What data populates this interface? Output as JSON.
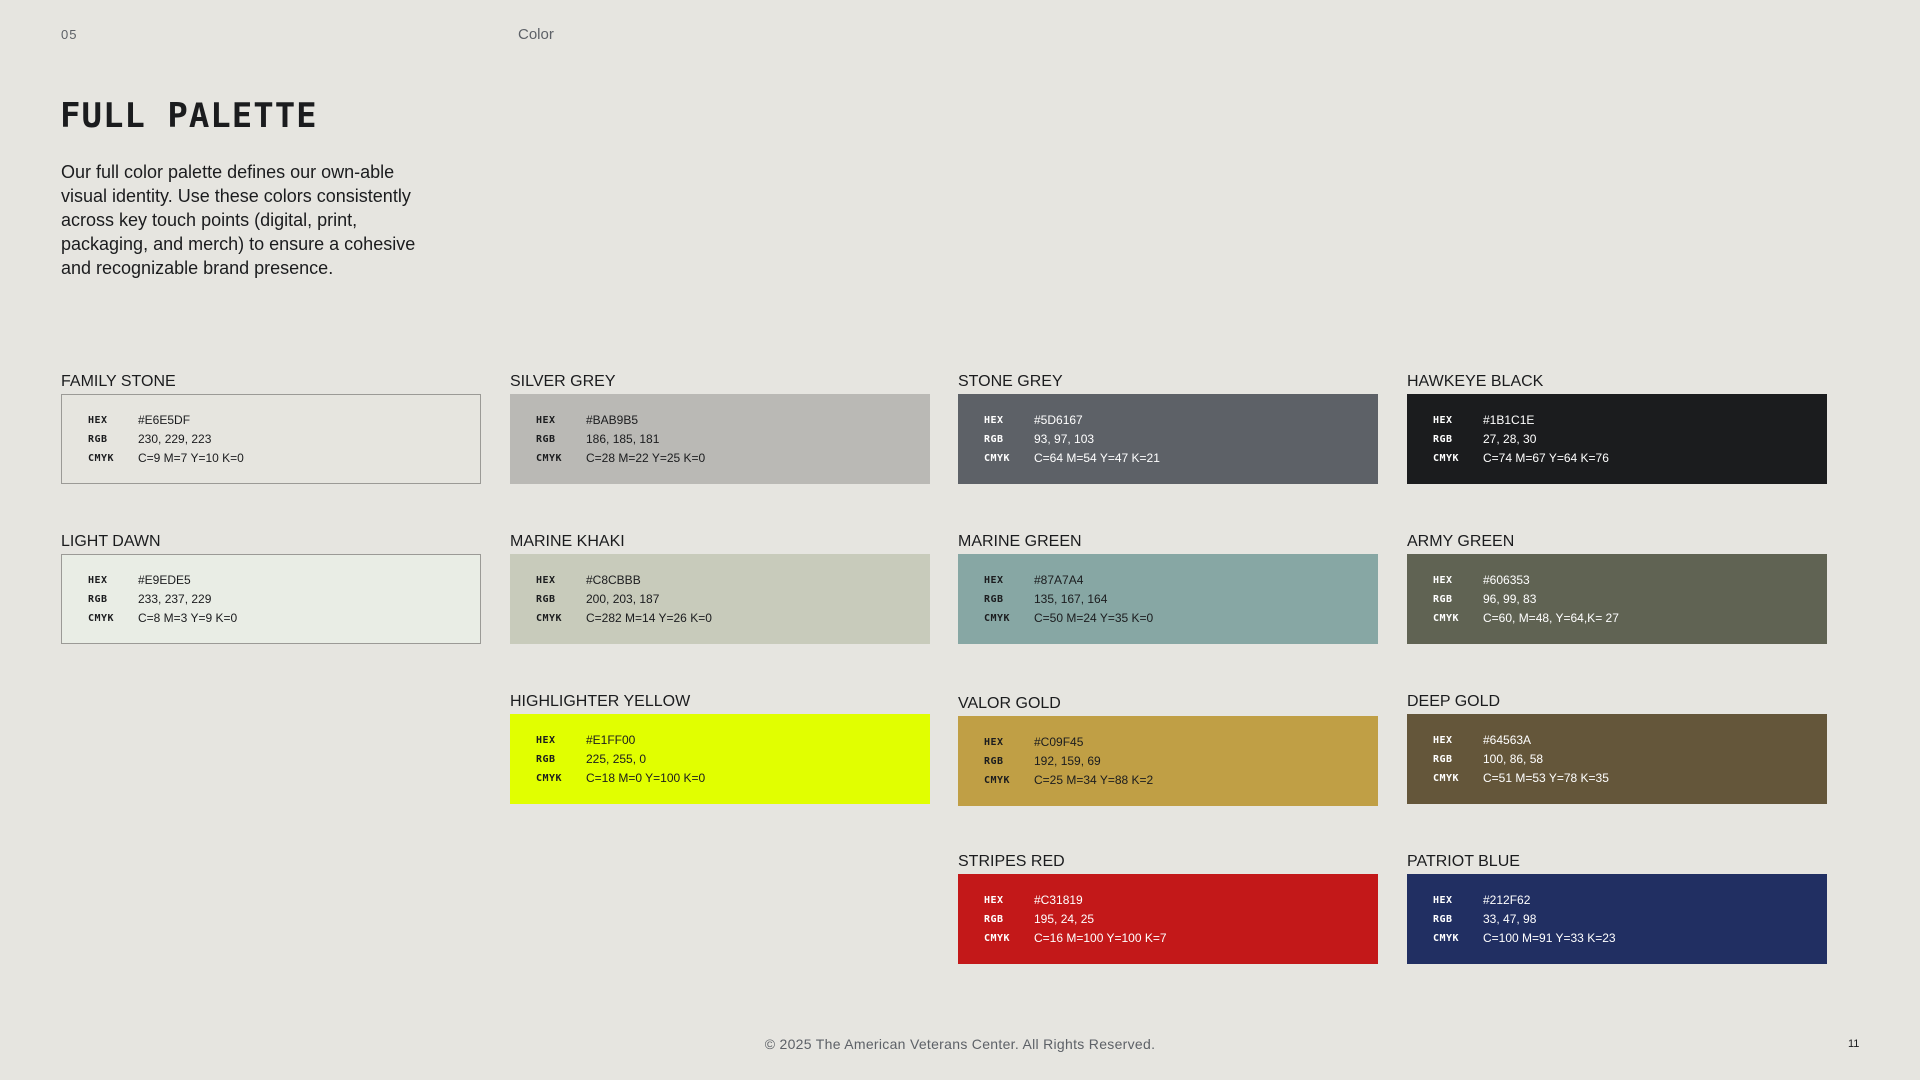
{
  "header": {
    "page_number": "05",
    "section": "Color"
  },
  "title": "FULL PALETTE",
  "intro": "Our full color palette defines our own-able visual identity. Use these colors consistently across key touch points (digital, print, packaging, and merch) to ensure a cohesive and recognizable brand presence.",
  "labels": {
    "hex": "HEX",
    "rgb": "RGB",
    "cmyk": "CMYK"
  },
  "swatches": [
    {
      "name": "FAMILY STONE",
      "hex": "#E6E5DF",
      "rgb": "230, 229, 223",
      "cmyk": "C=9 M=7 Y=10 K=0",
      "color": "#E6E5DF",
      "text_color": "#1B1C1E",
      "bordered": true
    },
    {
      "name": "SILVER GREY",
      "hex": "#BAB9B5",
      "rgb": "186, 185, 181",
      "cmyk": "C=28 M=22 Y=25 K=0",
      "color": "#BAB9B5",
      "text_color": "#1B1C1E",
      "bordered": false
    },
    {
      "name": "STONE GREY",
      "hex": "#5D6167",
      "rgb": "93, 97, 103",
      "cmyk": "C=64 M=54 Y=47 K=21",
      "color": "#5D6167",
      "text_color": "#FFFFFF",
      "bordered": false
    },
    {
      "name": "HAWKEYE BLACK",
      "hex": "#1B1C1E",
      "rgb": "27, 28, 30",
      "cmyk": "C=74 M=67 Y=64 K=76",
      "color": "#1B1C1E",
      "text_color": "#FFFFFF",
      "bordered": false
    },
    {
      "name": "LIGHT DAWN",
      "hex": "#E9EDE5",
      "rgb": "233, 237, 229",
      "cmyk": "C=8 M=3 Y=9 K=0",
      "color": "#E9EDE5",
      "text_color": "#1B1C1E",
      "bordered": true
    },
    {
      "name": "MARINE KHAKI",
      "hex": "#C8CBBB",
      "rgb": "200, 203, 187",
      "cmyk": "C=282 M=14 Y=26 K=0",
      "color": "#C8CBBB",
      "text_color": "#1B1C1E",
      "bordered": false
    },
    {
      "name": "MARINE GREEN",
      "hex": "#87A7A4",
      "rgb": "135, 167, 164",
      "cmyk": "C=50 M=24 Y=35 K=0",
      "color": "#87A7A4",
      "text_color": "#1B1C1E",
      "bordered": false
    },
    {
      "name": "ARMY GREEN",
      "hex": "#606353",
      "rgb": "96, 99, 83",
      "cmyk": "C=60, M=48, Y=64,K= 27",
      "color": "#606353",
      "text_color": "#FFFFFF",
      "bordered": false
    },
    {
      "name": "HIGHLIGHTER YELLOW",
      "hex": "#E1FF00",
      "rgb": "225, 255, 0",
      "cmyk": "C=18 M=0 Y=100 K=0",
      "color": "#E1FF00",
      "text_color": "#1B1C1E",
      "bordered": false
    },
    {
      "name": "VALOR GOLD",
      "hex": "#C09F45",
      "rgb": "192, 159, 69",
      "cmyk": "C=25 M=34 Y=88 K=2",
      "color": "#C09F45",
      "text_color": "#1B1C1E",
      "bordered": false
    },
    {
      "name": "DEEP GOLD",
      "hex": "#64563A",
      "rgb": "100, 86, 58",
      "cmyk": "C=51 M=53 Y=78 K=35",
      "color": "#64563A",
      "text_color": "#FFFFFF",
      "bordered": false
    },
    {
      "name": "STRIPES RED",
      "hex": "#C31819",
      "rgb": "195, 24, 25",
      "cmyk": "C=16 M=100 Y=100 K=7",
      "color": "#C31819",
      "text_color": "#FFFFFF",
      "bordered": false
    },
    {
      "name": "PATRIOT BLUE",
      "hex": "#212F62",
      "rgb": "33, 47, 98",
      "cmyk": "C=100 M=91 Y=33 K=23",
      "color": "#212F62",
      "text_color": "#FFFFFF",
      "bordered": false
    }
  ],
  "footer": {
    "copyright": "© 2025 The American Veterans Center. All Rights Reserved.",
    "page_number": "11"
  }
}
